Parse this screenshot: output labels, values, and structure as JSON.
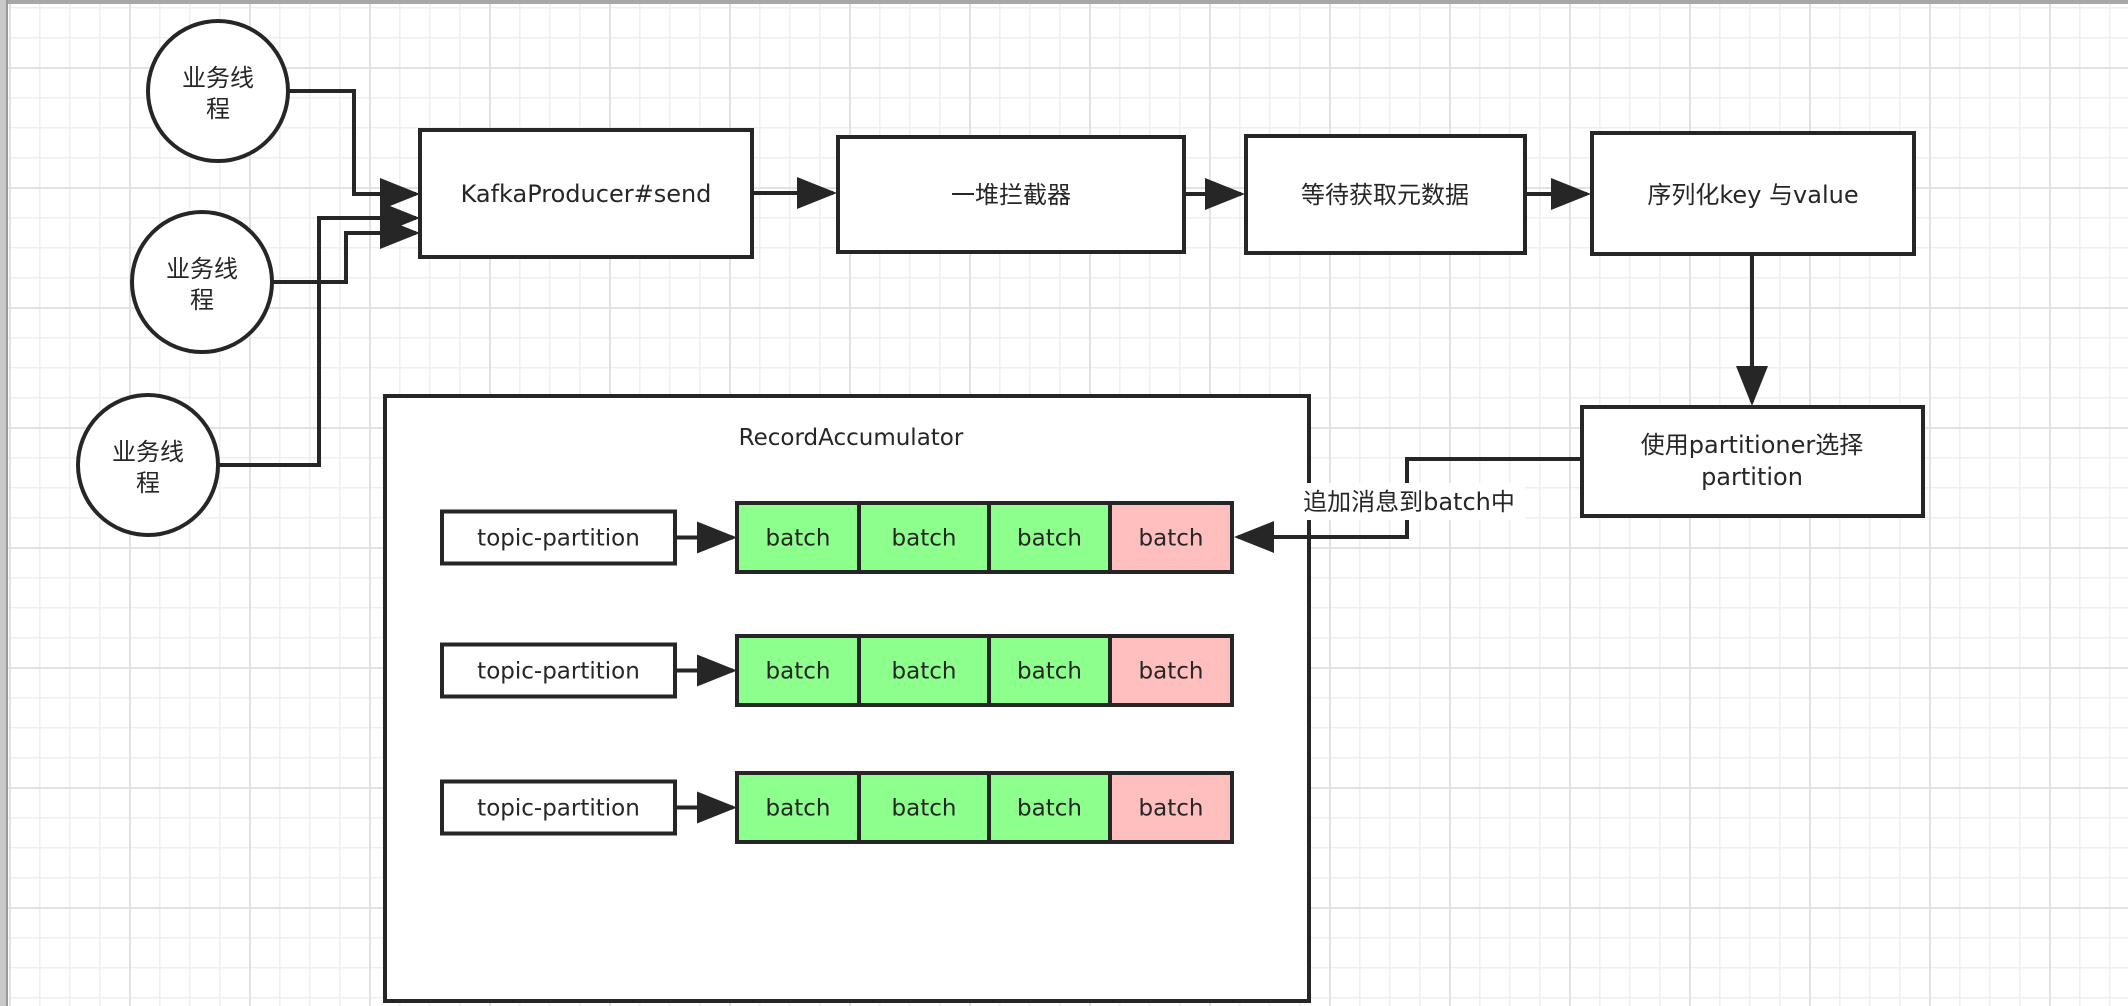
{
  "diagram": {
    "threads": [
      {
        "line1": "业务线",
        "line2": "程"
      },
      {
        "line1": "业务线",
        "line2": "程"
      },
      {
        "line1": "业务线",
        "line2": "程"
      }
    ],
    "pipeline": [
      {
        "label": "KafkaProducer#send"
      },
      {
        "label": "一堆拦截器"
      },
      {
        "label": "等待获取元数据"
      },
      {
        "label": "序列化key 与value"
      }
    ],
    "partitioner": {
      "line1": "使用partitioner选择",
      "line2": "partition"
    },
    "append_label": "追加消息到batch中",
    "accumulator": {
      "title": "RecordAccumulator",
      "rows": [
        {
          "partition_label": "topic-partition",
          "batches": [
            {
              "label": "batch",
              "state": "full"
            },
            {
              "label": "batch",
              "state": "full"
            },
            {
              "label": "batch",
              "state": "full"
            },
            {
              "label": "batch",
              "state": "open"
            }
          ]
        },
        {
          "partition_label": "topic-partition",
          "batches": [
            {
              "label": "batch",
              "state": "full"
            },
            {
              "label": "batch",
              "state": "full"
            },
            {
              "label": "batch",
              "state": "full"
            },
            {
              "label": "batch",
              "state": "open"
            }
          ]
        },
        {
          "partition_label": "topic-partition",
          "batches": [
            {
              "label": "batch",
              "state": "full"
            },
            {
              "label": "batch",
              "state": "full"
            },
            {
              "label": "batch",
              "state": "full"
            },
            {
              "label": "batch",
              "state": "open"
            }
          ]
        }
      ]
    },
    "colors": {
      "batch_full": "#8cff8c",
      "batch_open": "#ffbfbf",
      "stroke": "#262626"
    }
  }
}
